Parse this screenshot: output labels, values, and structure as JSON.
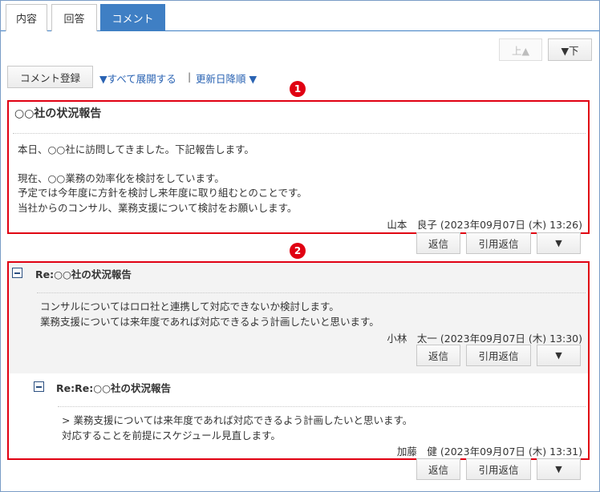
{
  "tabs": [
    {
      "label": "内容",
      "active": false
    },
    {
      "label": "回答",
      "active": false
    },
    {
      "label": "コメント",
      "active": true
    }
  ],
  "nav": {
    "up_label": "上▲",
    "down_label": "▼下"
  },
  "toolbar": {
    "register_label": "コメント登録",
    "expand_all_label": "▼すべて展開する",
    "separator": "|",
    "sort_label": "更新日降順 ▼"
  },
  "markers": [
    "1",
    "2"
  ],
  "comment1": {
    "title": "○○社の状況報告",
    "body": [
      "本日、○○社に訪問してきました。下記報告します。",
      "",
      "現在、○○業務の効率化を検討をしています。",
      "予定では今年度に方針を検討し来年度に取り組むとのことです。",
      "当社からのコンサル、業務支援について検討をお願いします。"
    ],
    "author": "山本　良子 (2023年09月07日 (木) 13:26)"
  },
  "actions": {
    "reply": "返信",
    "quote_reply": "引用返信",
    "more": "▼"
  },
  "reply1": {
    "title": "Re:○○社の状況報告",
    "body": [
      "コンサルについてはロロ社と連携して対応できないか検討します。",
      "業務支援については来年度であれば対応できるよう計画したいと思います。"
    ],
    "author": "小林　太一 (2023年09月07日 (木) 13:30)"
  },
  "reply2": {
    "title": "Re:Re:○○社の状況報告",
    "body": [
      "> 業務支援については来年度であれば対応できるよう計画したいと思います。",
      "対応することを前提にスケジュール見直します。"
    ],
    "author": "加藤　健 (2023年09月07日 (木) 13:31)"
  },
  "colors": {
    "accent": "#3f7fc4",
    "highlight": "#e00012",
    "link": "#2a63b3"
  }
}
